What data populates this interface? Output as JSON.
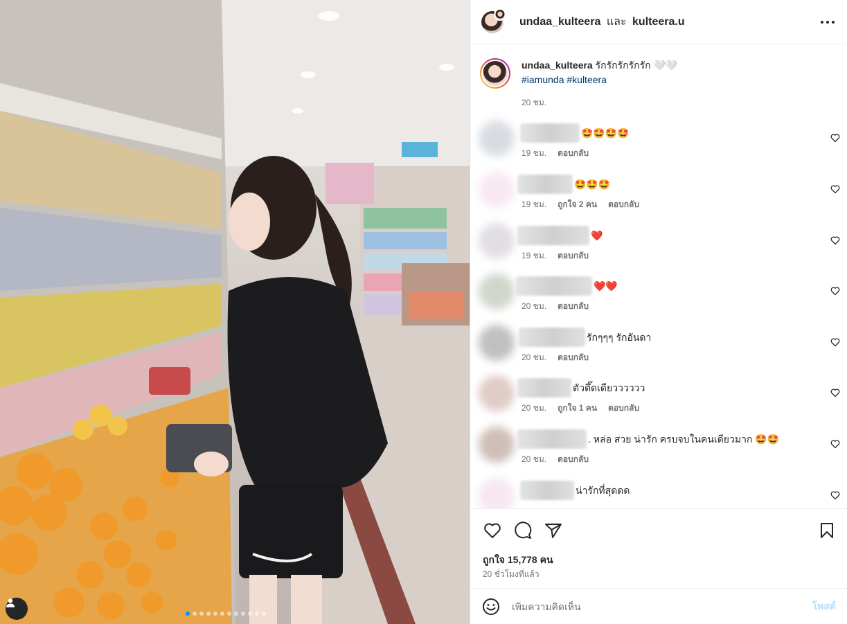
{
  "post": {
    "author": "undaa_kulteera",
    "and_text": "และ",
    "collaborator": "kulteera.u",
    "caption_text": "รักรักรักรักรัก 🤍🤍",
    "hashtags": "#iamunda #kulteera",
    "caption_time": "20 ชม."
  },
  "photo": {
    "carousel_dots": 12,
    "active_dot": 0
  },
  "comments": [
    {
      "text": "🤩🤩🤩🤩",
      "time": "19 ชม.",
      "likes": "",
      "reply": "ตอบกลับ"
    },
    {
      "text": "🤩🤩🤩",
      "time": "19 ชม.",
      "likes": "ถูกใจ 2 คน",
      "reply": "ตอบกลับ"
    },
    {
      "text": "❤️",
      "time": "19 ชม.",
      "likes": "",
      "reply": "ตอบกลับ"
    },
    {
      "text": "❤️❤️",
      "time": "20 ชม.",
      "likes": "",
      "reply": "ตอบกลับ"
    },
    {
      "text": "รักๆๆๆ รักอันดา",
      "time": "20 ชม.",
      "likes": "",
      "reply": "ตอบกลับ"
    },
    {
      "text": "ตัวตึ๊ดเดียวววววว",
      "time": "20 ชม.",
      "likes": "ถูกใจ 1 คน",
      "reply": "ตอบกลับ"
    },
    {
      "text": ". หล่อ สวย น่ารัก ครบจบในคนเดียวมาก 🤩🤩",
      "time": "20 ชม.",
      "likes": "",
      "reply": "ตอบกลับ"
    },
    {
      "text": "น่ารักที่สุดดด",
      "time": "",
      "likes": "",
      "reply": ""
    }
  ],
  "footer": {
    "likes_text": "ถูกใจ 15,778 คน",
    "time_ago": "20 ชั่วโมงที่แล้ว",
    "comment_placeholder": "เพิ่มความคิดเห็น",
    "post_label": "โพสต์"
  },
  "icons": [
    "more-icon",
    "like-icon",
    "comment-icon",
    "share-icon",
    "save-icon",
    "emoji-icon",
    "heart-small-icon",
    "user-icon"
  ],
  "colors": {
    "link": "#00376b",
    "post_button": "#b2dffc",
    "muted": "#737373",
    "active_dot": "#0095f6"
  }
}
